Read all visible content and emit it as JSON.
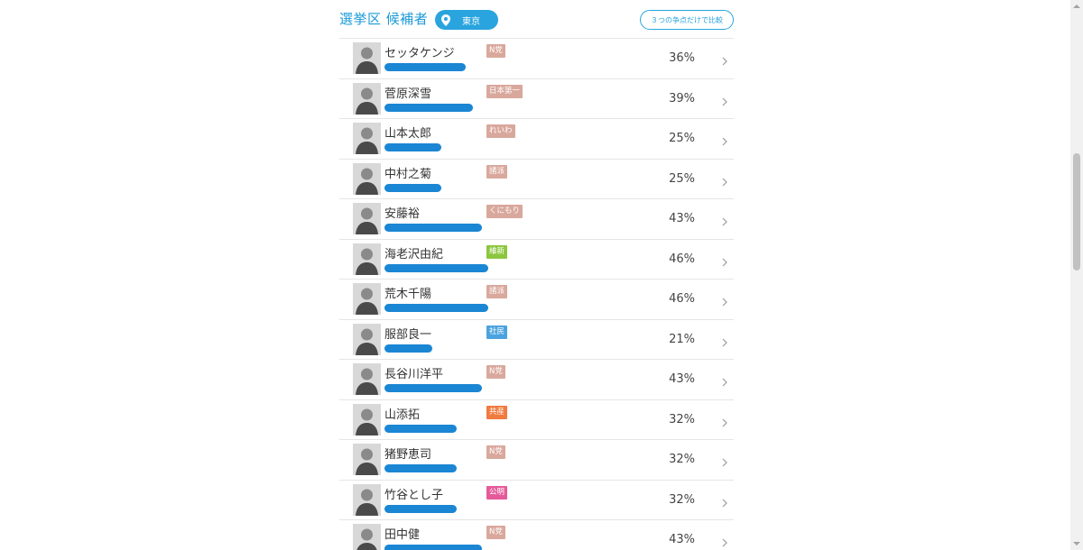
{
  "header": {
    "title": "選挙区 候補者",
    "region": "東京",
    "compare_label": "３つの争点だけで比較"
  },
  "colors": {
    "accent": "#1a9ad6",
    "bar": "#1a86d4"
  },
  "candidates": [
    {
      "name": "セッタケンジ",
      "party": "N党",
      "party_color": "#d9a89c",
      "percent": "36%",
      "fraction": 0.36
    },
    {
      "name": "菅原深雪",
      "party": "日本第一",
      "party_color": "#d9a89c",
      "percent": "39%",
      "fraction": 0.39
    },
    {
      "name": "山本太郎",
      "party": "れいわ",
      "party_color": "#d9a89c",
      "percent": "25%",
      "fraction": 0.25
    },
    {
      "name": "中村之菊",
      "party": "諸派",
      "party_color": "#d9a89c",
      "percent": "25%",
      "fraction": 0.25
    },
    {
      "name": "安藤裕",
      "party": "くにもり",
      "party_color": "#d9a89c",
      "percent": "43%",
      "fraction": 0.43
    },
    {
      "name": "海老沢由紀",
      "party": "維新",
      "party_color": "#8cc63f",
      "percent": "46%",
      "fraction": 0.46
    },
    {
      "name": "荒木千陽",
      "party": "諸派",
      "party_color": "#d9a89c",
      "percent": "46%",
      "fraction": 0.46
    },
    {
      "name": "服部良一",
      "party": "社民",
      "party_color": "#4aa3df",
      "percent": "21%",
      "fraction": 0.21
    },
    {
      "name": "長谷川洋平",
      "party": "N党",
      "party_color": "#d9a89c",
      "percent": "43%",
      "fraction": 0.43
    },
    {
      "name": "山添拓",
      "party": "共産",
      "party_color": "#f07b3f",
      "percent": "32%",
      "fraction": 0.32
    },
    {
      "name": "猪野恵司",
      "party": "N党",
      "party_color": "#d9a89c",
      "percent": "32%",
      "fraction": 0.32
    },
    {
      "name": "竹谷とし子",
      "party": "公明",
      "party_color": "#e55a9a",
      "percent": "32%",
      "fraction": 0.32
    },
    {
      "name": "田中健",
      "party": "N党",
      "party_color": "#d9a89c",
      "percent": "43%",
      "fraction": 0.43
    }
  ]
}
